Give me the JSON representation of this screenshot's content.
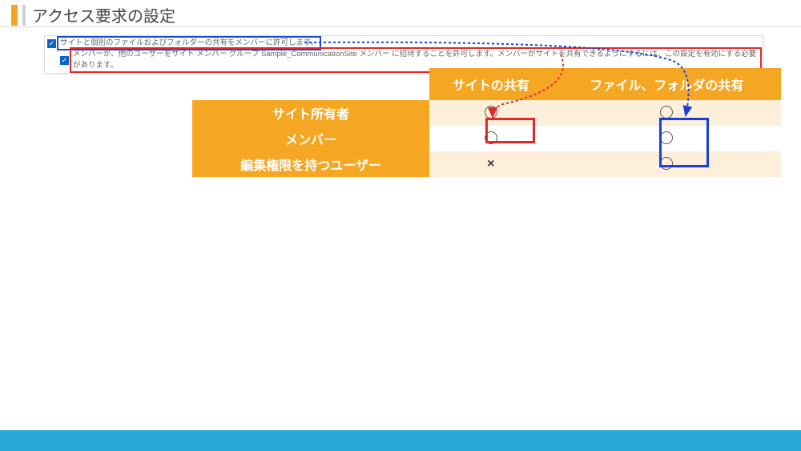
{
  "title": "アクセス要求の設定",
  "checkboxes": {
    "row1": "サイトと個別のファイルおよびフォルダーの共有をメンバーに許可します。",
    "row2": "メンバーが、他のユーザーをサイト メンバー グループ Sample_CommunicationSite メンバー に招待することを許可します。メンバーがサイトを共有できるようにするには、この設定を有効にする必要があります。"
  },
  "table": {
    "headers": [
      "",
      "サイトの共有",
      "ファイル、フォルダの共有"
    ],
    "rows": [
      {
        "label": "サイト所有者",
        "site": "○",
        "file": "○"
      },
      {
        "label": "メンバー",
        "site": "○",
        "file": "○"
      },
      {
        "label": "編集権限を持つユーザー",
        "site": "×",
        "file": "○"
      }
    ]
  }
}
